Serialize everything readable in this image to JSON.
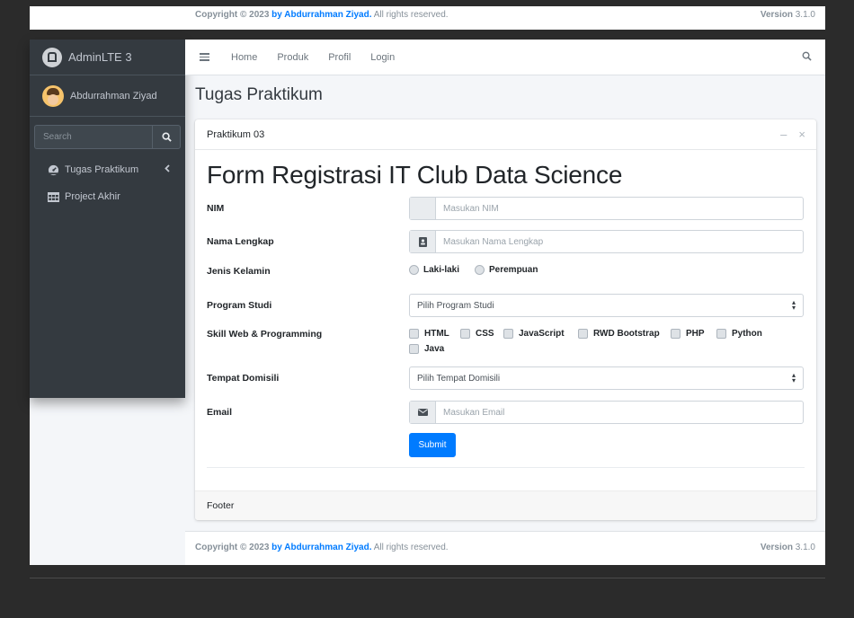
{
  "footer": {
    "copyright_prefix": "Copyright © 2023",
    "author": "by Abdurrahman Ziyad.",
    "rights": "All rights reserved.",
    "version_label": "Version",
    "version_number": "3.1.0"
  },
  "brand": {
    "name": "AdminLTE 3",
    "icon": "adminlte-logo-icon"
  },
  "user": {
    "name": "Abdurrahman Ziyad",
    "icon": "avatar"
  },
  "sidebar": {
    "search_placeholder": "Search",
    "items": [
      {
        "label": "Tugas Praktikum",
        "icon": "tachometer-icon",
        "has_chevron": true
      },
      {
        "label": "Project Akhir",
        "icon": "table-icon"
      }
    ]
  },
  "header": {
    "links": [
      "Home",
      "Produk",
      "Profil",
      "Login"
    ]
  },
  "content": {
    "title": "Tugas Praktikum"
  },
  "card": {
    "header": "Praktikum 03",
    "form_title": "Form Registrasi IT Club Data Science",
    "footer": "Footer",
    "fields": {
      "nim": {
        "label": "NIM",
        "placeholder": "Masukan NIM"
      },
      "nama": {
        "label": "Nama Lengkap",
        "placeholder": "Masukan Nama Lengkap",
        "icon": "address-book-icon"
      },
      "gender": {
        "label": "Jenis Kelamin",
        "options": [
          "Laki-laki",
          "Perempuan"
        ]
      },
      "prodi": {
        "label": "Program Studi",
        "selected": "Pilih Program Studi"
      },
      "skills": {
        "label": "Skill Web & Programming",
        "options": [
          "HTML",
          "CSS",
          "JavaScript",
          "RWD Bootstrap",
          "PHP",
          "Python",
          "Java"
        ]
      },
      "domisili": {
        "label": "Tempat Domisili",
        "selected": "Pilih Tempat Domisili"
      },
      "email": {
        "label": "Email",
        "placeholder": "Masukan Email",
        "icon": "envelope-icon"
      }
    },
    "submit_label": "Submit"
  },
  "colors": {
    "sidebar_bg": "#343a40",
    "primary": "#007bff",
    "content_bg": "#f4f6f9"
  }
}
